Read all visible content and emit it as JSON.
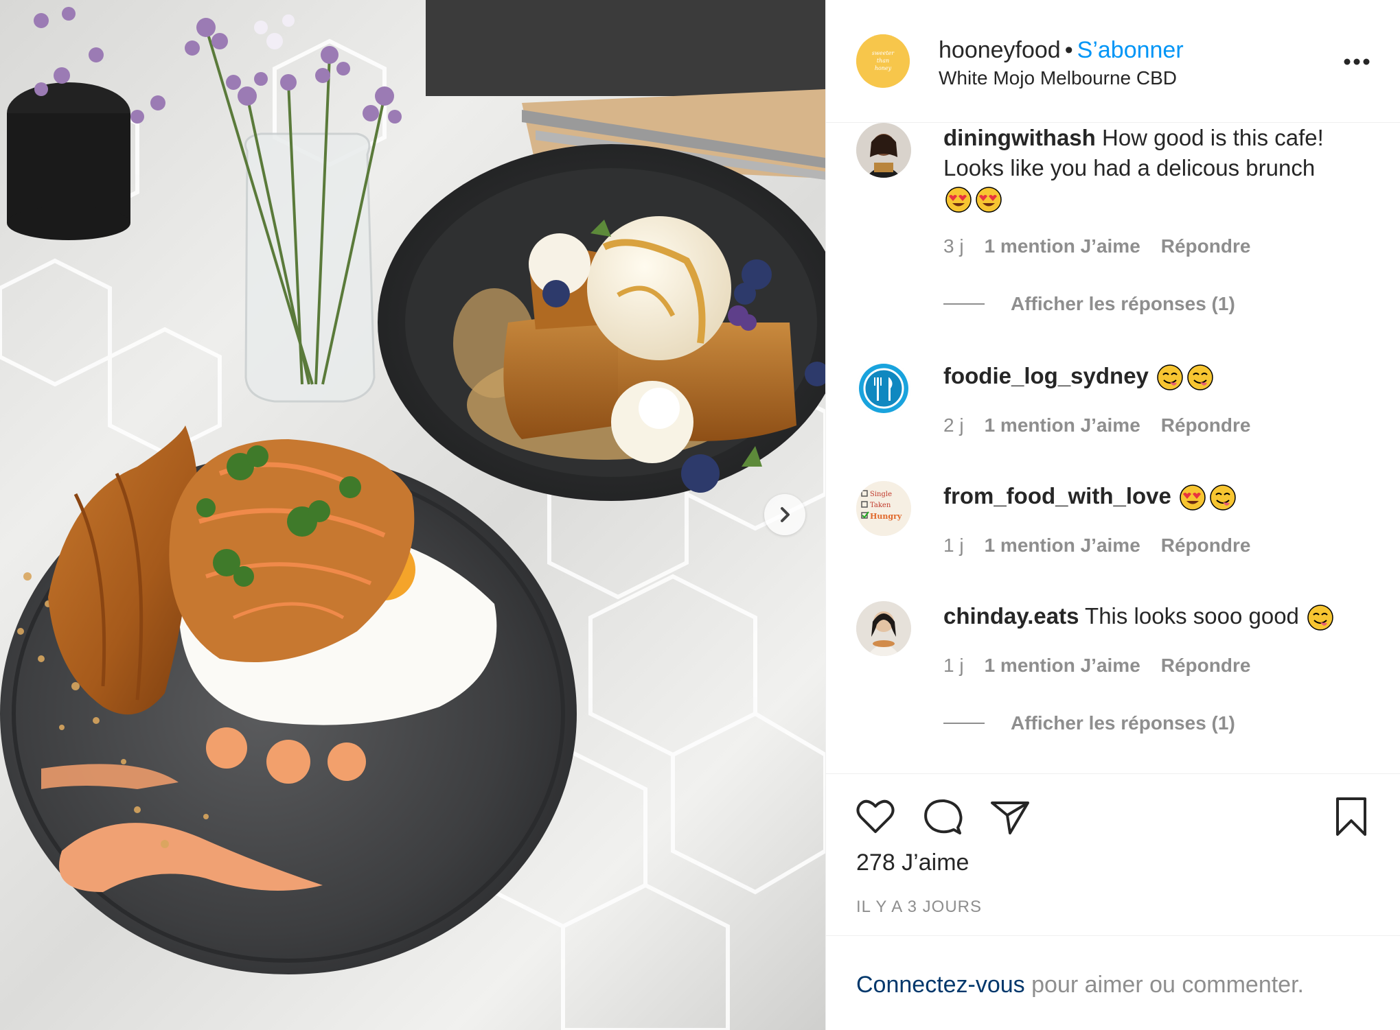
{
  "post": {
    "username": "hooneyfood",
    "separator": "•",
    "follow_label": "S’abonner",
    "location": "White Mojo Melbourne CBD",
    "avatar_text": [
      "sweeter",
      "than",
      "honey"
    ]
  },
  "comments": [
    {
      "username": "diningwithash",
      "text": "How good is this cafe! Looks like you had a delicous brunch",
      "emojis": [
        "heart-eyes-emoji",
        "heart-eyes-emoji"
      ],
      "age": "3 j",
      "likes": "1 mention J’aime",
      "reply": "Répondre",
      "view_replies": "Afficher les réponses (1)"
    },
    {
      "username": "foodie_log_sydney",
      "text": "",
      "emojis": [
        "yum-emoji",
        "yum-emoji"
      ],
      "age": "2 j",
      "likes": "1 mention J’aime",
      "reply": "Répondre"
    },
    {
      "username": "from_food_with_love",
      "text": "",
      "emojis": [
        "heart-eyes-emoji",
        "yum-emoji"
      ],
      "age": "1 j",
      "likes": "1 mention J’aime",
      "reply": "Répondre",
      "avatar_lines": [
        "Single",
        "Taken",
        "Hungry"
      ]
    },
    {
      "username": "chinday.eats",
      "text": "This looks sooo good",
      "emojis": [
        "yum-emoji"
      ],
      "age": "1 j",
      "likes": "1 mention J’aime",
      "reply": "Répondre",
      "view_replies": "Afficher les réponses (1)"
    }
  ],
  "actions": {
    "icons": [
      "heart-icon",
      "comment-icon",
      "share-icon",
      "bookmark-icon"
    ],
    "likes_count": "278 J’aime",
    "timestamp": "IL Y A 3 JOURS"
  },
  "login": {
    "link": "Connectez-vous",
    "rest": " pour aimer ou commenter."
  },
  "colors": {
    "accent_blue": "#0095f6",
    "link_dark_blue": "#00376b",
    "text": "#262626",
    "muted": "#8e8e8e",
    "avatar_yellow": "#f7c64b"
  }
}
